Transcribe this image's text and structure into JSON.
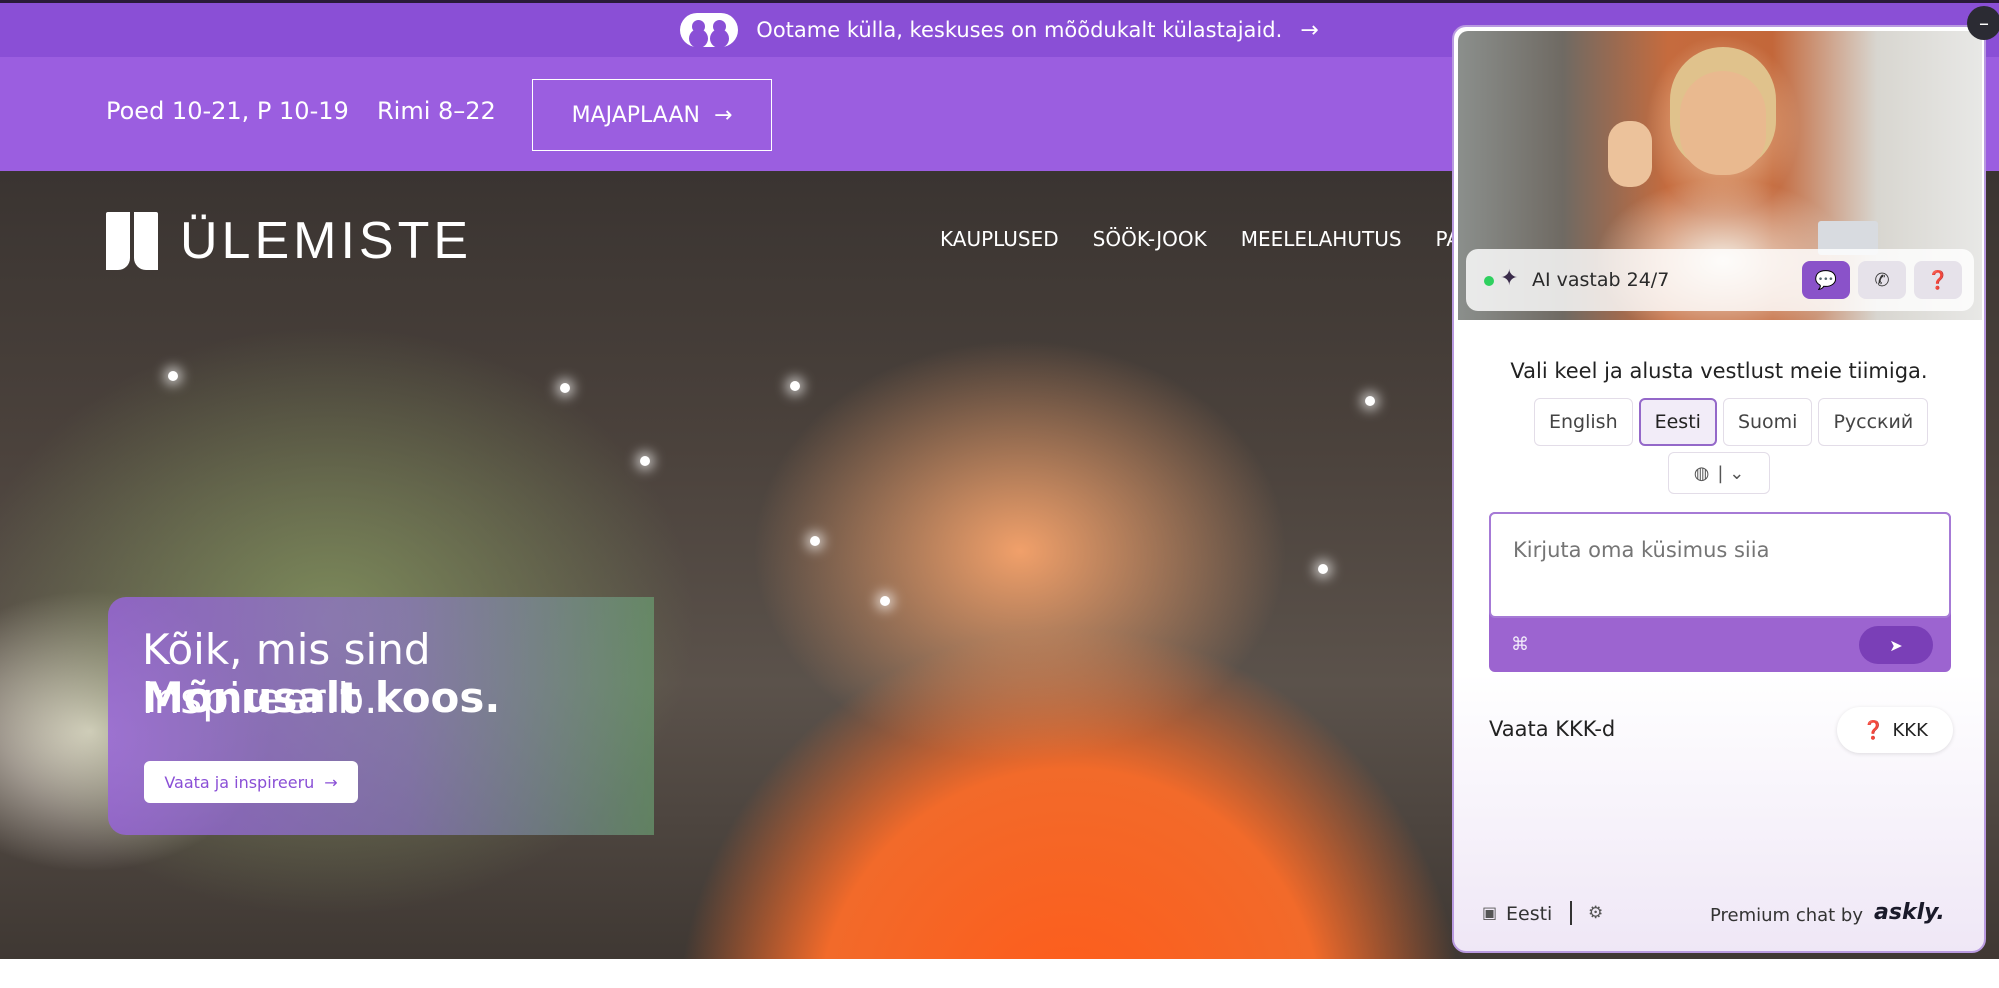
{
  "announcement": {
    "text": "Ootame külla, keskuses on mõõdukalt külastajaid.",
    "arrow": "→"
  },
  "infobar": {
    "hours": "Poed 10-21, P 10-19",
    "rimi_hours": "Rimi 8–22",
    "map_button": "MAJAPLAAN",
    "map_arrow": "→"
  },
  "header": {
    "logo_text": "ÜLEMISTE",
    "nav": [
      "KAUPLUSED",
      "SÖÖK-JOOK",
      "MEELELAHUTUS",
      "PAK"
    ]
  },
  "hero": {
    "headline": "Kõik, mis sind inspireerib.",
    "headline_bold": "Mõnusalt koos.",
    "cta": "Vaata ja inspireeru",
    "cta_arrow": "→"
  },
  "chat": {
    "status_label": "AI vastab 24/7",
    "sparkle_glyph": "✦",
    "chat_glyph": "💬",
    "phone_glyph": "✆",
    "faq_glyph": "❓",
    "prompt": "Vali keel ja alusta vestlust meie tiimiga.",
    "languages": [
      "English",
      "Eesti",
      "Suomi",
      "Русский"
    ],
    "active_language": "Eesti",
    "globe_glyph": "◍",
    "chevron_glyph": "| ⌄",
    "input_placeholder": "Kirjuta oma küsimus siia",
    "clip_glyph": "⌘",
    "send_glyph": "➤",
    "faq_label": "Vaata KKK-d",
    "faq_button": "KKK",
    "footer_language": "Eesti",
    "footer_flag_glyph": "▣",
    "gear_glyph": "⚙",
    "powered_by": "Premium chat by",
    "brand": "askly.",
    "minimize_glyph": "–"
  },
  "colors": {
    "brand_purple": "#9b5ee0",
    "announce_purple": "#8a4fd6",
    "chat_accent": "#8a52c9",
    "status_green": "#2fd05f"
  }
}
